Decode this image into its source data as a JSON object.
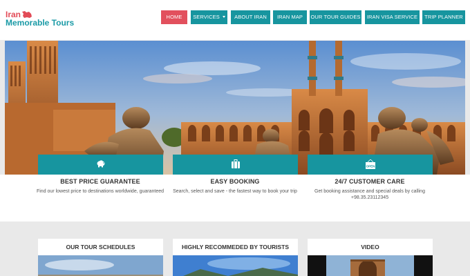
{
  "logo": {
    "line1": "Iran",
    "line2": "Memorable Tours"
  },
  "nav": {
    "home": "HOME",
    "services": "SERVICES",
    "about": "ABOUT IRAN",
    "map": "IRAN MAP",
    "guides": "OUR TOUR GUIDES",
    "visa": "IRAN VISA SERVICE",
    "planner": "TRIP PLANNER"
  },
  "features": [
    {
      "title": "BEST PRICE GUARANTEE",
      "desc": "Find our lowest price to destinations worldwide, guaranteed",
      "icon": "piggy-bank-icon"
    },
    {
      "title": "EASY BOOKING",
      "desc": "Search, select and save - the fastest way to book your trip",
      "icon": "suitcase-icon"
    },
    {
      "title": "24/7 CUSTOMER CARE",
      "desc": "Get booking assistance and special deals by calling +98.35.23112345",
      "icon": "open-sign-icon",
      "icon_text": "OPEN"
    }
  ],
  "cards": [
    {
      "title": "OUR TOUR SCHEDULES"
    },
    {
      "title": "HIGHLY RECOMMEDED BY TOURISTS"
    },
    {
      "title": "VIDEO"
    }
  ],
  "colors": {
    "teal": "#17959f",
    "red": "#e2505d",
    "background": "#e9e9e9"
  }
}
